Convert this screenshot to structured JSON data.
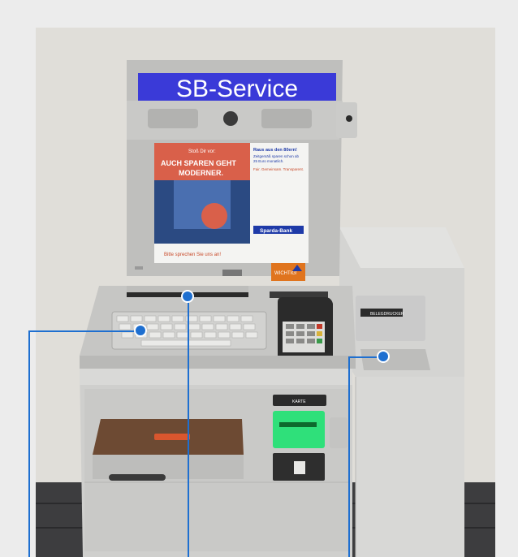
{
  "kiosk": {
    "header_sign": "SB-Service",
    "screen": {
      "promo_small": "Stoß Dir vor:",
      "promo_headline_1": "AUCH SPAREN GEHT",
      "promo_headline_2": "MODERNER.",
      "side_title": "Raus aus den 80ern!",
      "side_text_1": "Zeitgemäß sparen schon ab",
      "side_text_2": "25 Euro monatlich.",
      "side_text_3": "Fair. Gemeinsam. Transparent.",
      "bank_logo": "Sparda-Bank",
      "footer_text": "Bitte sprechen Sie uns an!",
      "wichtig_label": "WICHTIG!"
    },
    "card_slot_label": "KARTE",
    "receipt_label": "BELEGDRUCKER"
  },
  "colors": {
    "callout": "#1e6fd0",
    "sign_blue": "#3a3ad8",
    "card_slot_glow": "#2fe07a",
    "screen_red": "#c94a2a"
  }
}
